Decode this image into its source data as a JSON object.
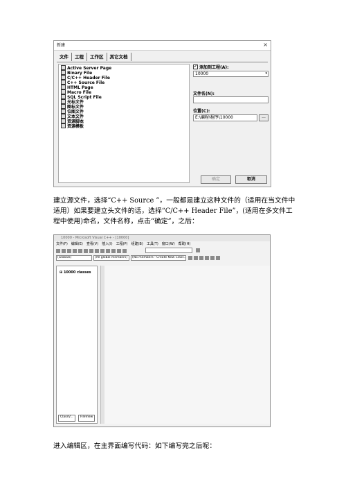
{
  "dialog": {
    "title": "新建",
    "close": "×",
    "tabs": [
      "文件",
      "工程",
      "工作区",
      "其它文档"
    ],
    "file_types": [
      "Active Server Page",
      "Binary File",
      "C/C++ Header File",
      "C++ Source File",
      "HTML Page",
      "Macro File",
      "SQL Script File",
      "光标文件",
      "图标文件",
      "位图文件",
      "文本文件",
      "资源脚本",
      "资源模板"
    ],
    "add_to_project_label": "添加到工程(A):",
    "add_to_project_checked": "✔",
    "project_value": "10000",
    "file_name_label": "文件名(N):",
    "file_name_value": "",
    "location_label": "位置(C):",
    "location_value": "E:\\编程\\程序\\10000",
    "browse_label": "...",
    "ok_label": "确定",
    "cancel_label": "取消"
  },
  "paragraph1": "建立源文件，选择“C++ Source ”，一般都是建立这种文件的（适用在当文件中适用）如果要建立头文件的话，选择“C/C++ Header File”，(适用在多文件工程中使用)命名，文件名称，点击“确定”，之后：",
  "ide": {
    "title": "10000 - Microsoft Visual C++ - [10000]",
    "menus": [
      "文件(F)",
      "编辑(E)",
      "查看(V)",
      "插入(I)",
      "工程(P)",
      "组建(B)",
      "工具(T)",
      "窗口(W)",
      "帮助(H)"
    ],
    "combo_globals": "(Globals)",
    "combo_members": "(All global members)",
    "combo_nomembers": "(No members - Create New Class...)",
    "workspace_item": "10000 classes",
    "tab_classview": "ClassV...",
    "tab_fileview": "FileView"
  },
  "paragraph2": "进入编辑区，在主界面编写代码：如下编写完之后呢："
}
